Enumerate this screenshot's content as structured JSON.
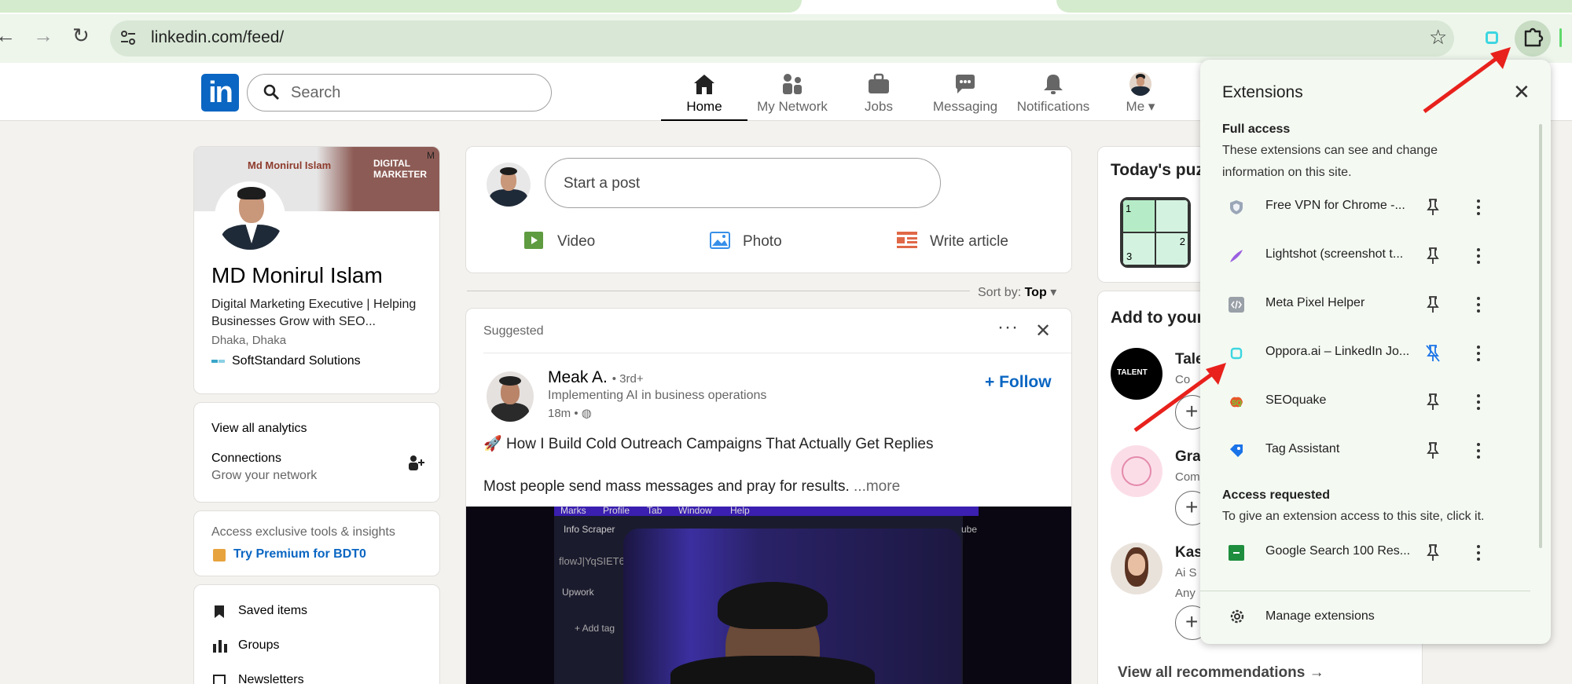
{
  "browser": {
    "url": "linkedin.com/feed/",
    "back_glyph": "←",
    "forward_glyph": "→",
    "reload_glyph": "↻",
    "star_glyph": "☆"
  },
  "header": {
    "logo_text": "in",
    "search_placeholder": "Search",
    "nav": [
      {
        "label": "Home",
        "icon": "home-icon"
      },
      {
        "label": "My Network",
        "icon": "my-network-icon"
      },
      {
        "label": "Jobs",
        "icon": "jobs-icon"
      },
      {
        "label": "Messaging",
        "icon": "messaging-icon"
      },
      {
        "label": "Notifications",
        "icon": "notifications-icon"
      },
      {
        "label": "Me",
        "icon": "me-avatar"
      }
    ]
  },
  "profile": {
    "banner_name": "Md  Monirul Islam",
    "banner_line1": "DIGITAL",
    "banner_line2": "MARKETER",
    "banner_corner": "M",
    "name": "MD Monirul Islam",
    "headline": "Digital Marketing Executive | Helping Businesses Grow with SEO...",
    "location": "Dhaka, Dhaka",
    "company": "SoftStandard Solutions"
  },
  "analytics": {
    "view_all": "View all analytics",
    "connections": "Connections",
    "connections_sub": "Grow your network"
  },
  "premium": {
    "promo": "Access exclusive tools & insights",
    "cta": "Try Premium for BDT0"
  },
  "shortcuts": {
    "items": [
      "Saved items",
      "Groups",
      "Newsletters"
    ]
  },
  "share_box": {
    "placeholder": "Start a post",
    "video": "Video",
    "photo": "Photo",
    "article": "Write article"
  },
  "sort": {
    "label": "Sort by:",
    "value": "Top"
  },
  "post": {
    "suggested": "Suggested",
    "author": "Meak A.",
    "degree": "• 3rd+",
    "subtitle": "Implementing AI in business operations",
    "time": "18m •",
    "follow": "Follow",
    "text1": "How I Build Cold Outreach Campaigns That Actually Get Replies",
    "text2": "Most people send mass messages and pray for results.",
    "more": "...more",
    "media_texts": [
      "Marks",
      "Profile",
      "Tab",
      "Window",
      "Help",
      "Info Scraper",
      "flowJ|YqSIET6",
      "Upwork",
      "+ Add tag",
      "ube"
    ]
  },
  "right": {
    "puzzle_title": "Today's puz",
    "puzzle_cells": [
      "1",
      "2",
      "3"
    ],
    "add_title": "Add to your",
    "suggestions": [
      {
        "name": "Tale",
        "sub": "Co",
        "avatar_text": "TALENT"
      },
      {
        "name": "Gra",
        "sub": "Com"
      },
      {
        "name": "Kas",
        "sub": "Ai S",
        "sub2": "Any"
      }
    ],
    "view_all": "View all recommendations →"
  },
  "extensions": {
    "title": "Extensions",
    "full_access_title": "Full access",
    "full_access_desc": "These extensions can see and change information on this site.",
    "items": [
      {
        "name": "Free VPN for Chrome -...",
        "icon": "vpn-shield-icon",
        "pinned": false
      },
      {
        "name": "Lightshot (screenshot t...",
        "icon": "lightshot-feather-icon",
        "pinned": false
      },
      {
        "name": "Meta Pixel Helper",
        "icon": "meta-pixel-icon",
        "pinned": false
      },
      {
        "name": "Oppora.ai – LinkedIn Jo...",
        "icon": "oppora-icon",
        "pinned": true
      },
      {
        "name": "SEOquake",
        "icon": "seoquake-icon",
        "pinned": false
      },
      {
        "name": "Tag Assistant",
        "icon": "tag-assistant-icon",
        "pinned": false
      }
    ],
    "access_requested_title": "Access requested",
    "access_requested_desc": "To give an extension access to this site, click it.",
    "requested_items": [
      {
        "name": "Google Search 100 Res...",
        "icon": "google-search-100-icon",
        "pinned": false
      }
    ],
    "manage": "Manage extensions"
  },
  "colors": {
    "linkedin_blue": "#0a66c2",
    "chrome_toolbar": "#eef6ec",
    "popup_bg": "#f4f9f2",
    "arrow_red": "#e8211c"
  }
}
